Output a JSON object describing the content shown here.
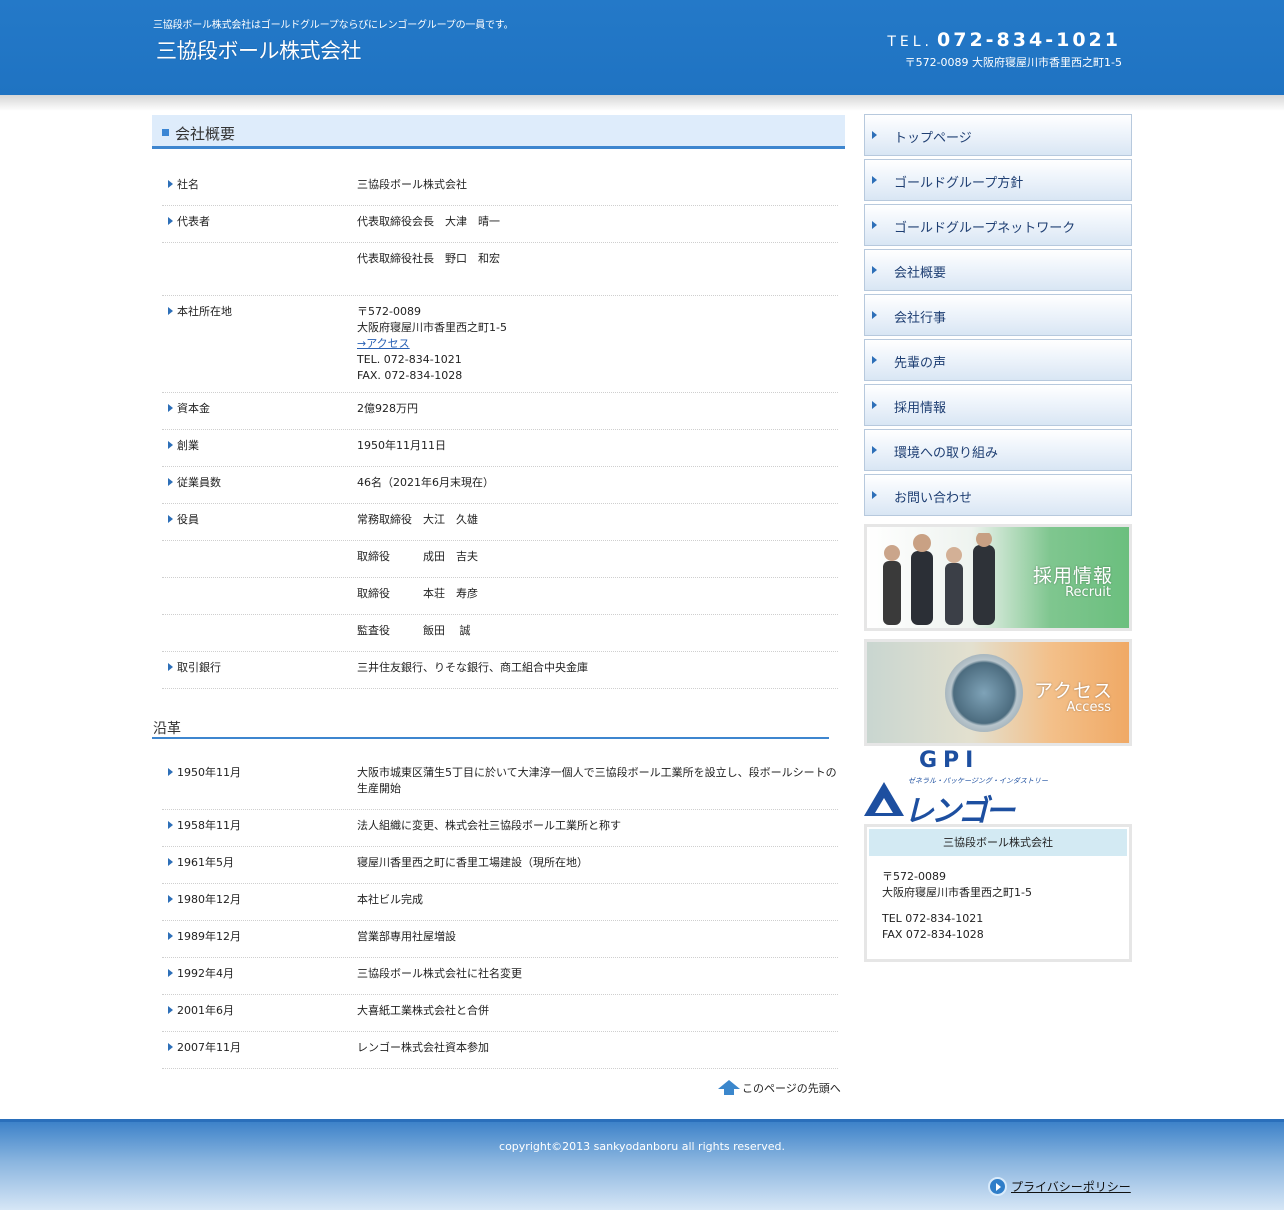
{
  "header": {
    "tagline": "三協段ボール株式会社はゴールドグループならびにレンゴーグループの一員です。",
    "logo": "三協段ボール株式会社",
    "tel_label": "TEL.",
    "tel_number": "072-834-1021",
    "address": "〒572-0089 大阪府寝屋川市香里西之町1-5"
  },
  "main": {
    "page_title": "会社概要",
    "info_rows": [
      {
        "key": "社名",
        "value": "三協段ボール株式会社"
      },
      {
        "key": "代表者",
        "value": "代表取締役会長　大津　晴一"
      },
      {
        "key": "",
        "value": "代表取締役社長　野口　和宏"
      },
      {
        "key": "本社所在地",
        "lines": [
          "〒572-0089",
          "大阪府寝屋川市香里西之町1-5"
        ],
        "link": "→アクセス",
        "lines2": [
          "TEL. 072-834-1021",
          "FAX. 072-834-1028"
        ]
      },
      {
        "key": "資本金",
        "value": "2億928万円"
      },
      {
        "key": "創業",
        "value": "1950年11月11日"
      },
      {
        "key": "従業員数",
        "value": "46名（2021年6月末現在）"
      },
      {
        "key": "役員",
        "value": "常務取締役　大江　久雄"
      },
      {
        "key": "",
        "value": "取締役　　　成田　吉夫"
      },
      {
        "key": "",
        "value": "取締役　　　本荘　寿彦"
      },
      {
        "key": "",
        "value": "監査役　　　飯田　 誠"
      },
      {
        "key": "取引銀行",
        "value": "三井住友銀行、りそな銀行、商工組合中央金庫"
      }
    ],
    "history_title": "沿革",
    "history_rows": [
      {
        "key": "1950年11月",
        "value": "大阪市城東区蒲生5丁目に於いて大津淳一個人で三協段ボール工業所を設立し、段ボールシートの生産開始"
      },
      {
        "key": "1958年11月",
        "value": "法人組織に変更、株式会社三協段ボール工業所と称す"
      },
      {
        "key": "1961年5月",
        "value": "寝屋川香里西之町に香里工場建設（現所在地）"
      },
      {
        "key": "1980年12月",
        "value": "本社ビル完成"
      },
      {
        "key": "1989年12月",
        "value": "営業部専用社屋増設"
      },
      {
        "key": "1992年4月",
        "value": "三協段ボール株式会社に社名変更"
      },
      {
        "key": "2001年6月",
        "value": "大喜紙工業株式会社と合併"
      },
      {
        "key": "2007年11月",
        "value": "レンゴー株式会社資本参加"
      }
    ],
    "page_top": "このページの先頭へ"
  },
  "sidebar": {
    "nav": [
      "トップページ",
      "ゴールドグループ方針",
      "ゴールドグループネットワーク",
      "会社概要",
      "会社行事",
      "先輩の声",
      "採用情報",
      "環境への取り組み",
      "お問い合わせ"
    ],
    "banner_recruit": {
      "main": "採用情報",
      "sub": "Recruit"
    },
    "banner_access": {
      "main": "アクセス",
      "sub": "Access"
    },
    "gpi": {
      "text": "GPI",
      "sub": "ゼネラル・パッケージング・インダストリー",
      "rengo": "レンゴー"
    },
    "company_box": {
      "title": "三協段ボール株式会社",
      "postal": "〒572-0089",
      "address": "大阪府寝屋川市香里西之町1-5",
      "tel": "TEL 072-834-1021",
      "fax": "FAX 072-834-1028"
    }
  },
  "footer": {
    "copyright": "copyright©2013 sankyodanboru all rights reserved.",
    "privacy": "プライバシーポリシー"
  }
}
